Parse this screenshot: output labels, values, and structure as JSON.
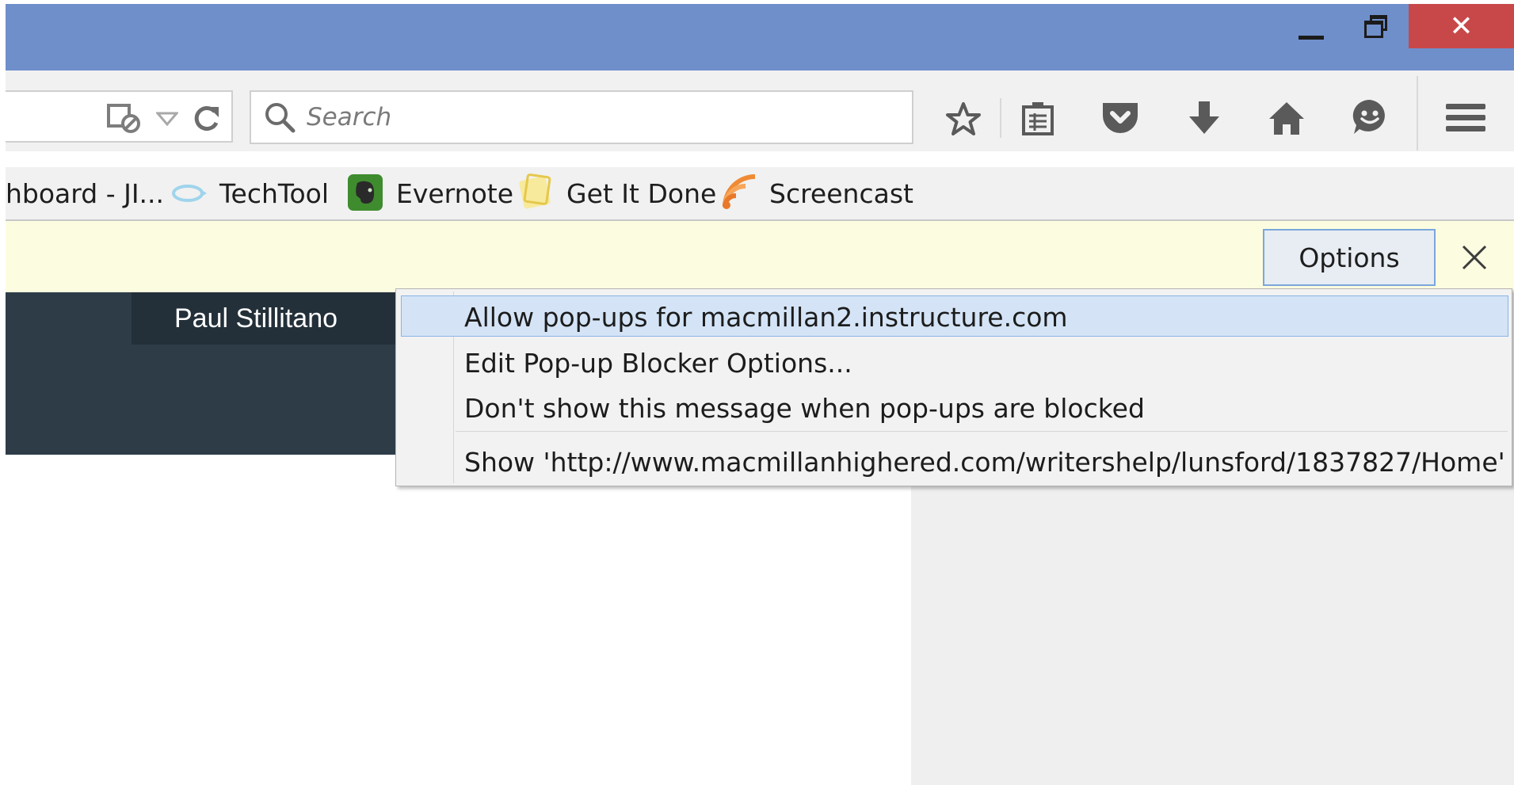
{
  "window": {
    "minimize_icon": "minimize-icon",
    "maximize_icon": "restore-icon",
    "close_symbol": "✕"
  },
  "toolbar": {
    "search_placeholder": "Search",
    "icons": [
      "reader-view-icon",
      "dropdown-arrow-icon",
      "reload-icon",
      "search-icon",
      "bookmark-star-icon",
      "reading-list-icon",
      "pocket-icon",
      "download-icon",
      "home-icon",
      "hello-icon",
      "menu-icon"
    ]
  },
  "bookmarks": {
    "items": [
      {
        "label": "hboard - JI...",
        "icon": ""
      },
      {
        "label": "TechTool",
        "icon": "techtool-icon"
      },
      {
        "label": "Evernote",
        "icon": "evernote-icon"
      },
      {
        "label": "Get It Done",
        "icon": "getitdone-icon"
      },
      {
        "label": "Screencast",
        "icon": "screencast-icon"
      }
    ]
  },
  "notification": {
    "options_label": "Options",
    "close_icon": "close-icon"
  },
  "page": {
    "user_name": "Paul Stillitano"
  },
  "popup_menu": {
    "items": [
      {
        "label": "Allow pop-ups for macmillan2.instructure.com",
        "highlighted": true
      },
      {
        "label": "Edit Pop-up Blocker Options..."
      },
      {
        "label": "Don't show this message when pop-ups are blocked"
      },
      {
        "label": "Show 'http://www.macmillanhighered.com/writershelp/lunsford/1837827/Home'"
      }
    ]
  },
  "colors": {
    "titlebar": "#6f8fcb",
    "close_button": "#c8484a",
    "notification_bar": "#fcfce0",
    "page_header": "#2e3c48",
    "menu_highlight": "#d4e4f6"
  }
}
